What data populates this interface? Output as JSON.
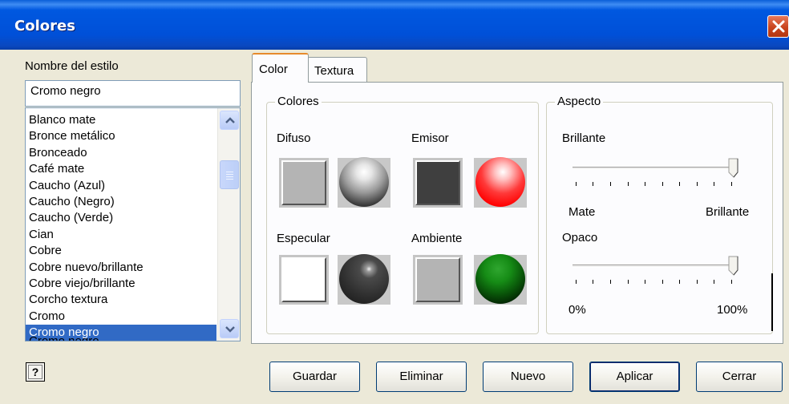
{
  "window": {
    "title": "Colores"
  },
  "left": {
    "style_name_label": "Nombre del estilo",
    "style_name_value": "Cromo negro",
    "styles": [
      "Blanco mate",
      "Bronce metálico",
      "Bronceado",
      "Café mate",
      "Caucho (Azul)",
      "Caucho (Negro)",
      "Caucho (Verde)",
      "Cian",
      "Cobre",
      "Cobre nuevo/brillante",
      "Cobre viejo/brillante",
      "Corcho textura",
      "Cromo",
      "Cromo negro"
    ],
    "selected_style": "Cromo negro"
  },
  "tabs": [
    {
      "label": "Color",
      "active": true
    },
    {
      "label": "Textura",
      "active": false
    }
  ],
  "colores": {
    "legend": "Colores",
    "difuso": {
      "label": "Difuso",
      "swatch": "#b4b4b4"
    },
    "emisor": {
      "label": "Emisor",
      "swatch": "#3f3f3f"
    },
    "especular": {
      "label": "Especular",
      "swatch": "#ffffff"
    },
    "ambiente": {
      "label": "Ambiente",
      "swatch": "#b4b4b4"
    }
  },
  "aspecto": {
    "legend": "Aspecto",
    "brillante": {
      "label": "Brillante",
      "min_label": "Mate",
      "max_label": "Brillante",
      "value_fraction": 1.0
    },
    "opaco": {
      "label": "Opaco",
      "min_label": "0%",
      "max_label": "100%",
      "value_fraction": 1.0
    }
  },
  "buttons": {
    "guardar": "Guardar",
    "eliminar": "Eliminar",
    "nuevo": "Nuevo",
    "aplicar": "Aplicar",
    "cerrar": "Cerrar",
    "help": "?"
  },
  "icons": {
    "close": "close-icon",
    "help": "help-icon",
    "scroll_up": "chevron-up-icon",
    "scroll_down": "chevron-down-icon"
  }
}
